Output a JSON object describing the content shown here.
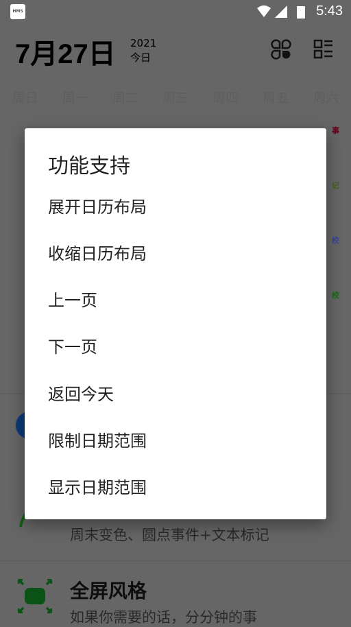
{
  "status_bar": {
    "app_icon": "HMS",
    "time": "5:43",
    "icons": [
      "wifi-icon",
      "signal-icon",
      "battery-charging-icon"
    ]
  },
  "header": {
    "date": "7月27日",
    "year": "2021",
    "today": "今日",
    "icons": [
      "clover-icon",
      "list-layout-icon"
    ]
  },
  "week_days": [
    "周日",
    "周一",
    "周二",
    "周三",
    "周四",
    "周五",
    "周六"
  ],
  "calendar_marks": [
    {
      "text": "事",
      "color": "#a8002a"
    },
    {
      "text": "记",
      "color": "#6b8e23"
    },
    {
      "text": "校",
      "color": "#5060c0"
    },
    {
      "text": "校",
      "color": "#2a9a2a"
    }
  ],
  "features": [
    {
      "subtitle": "周末变色、圆点事件+文本标记",
      "icon": "leaf-icon",
      "color": "#1f8a1f"
    },
    {
      "title": "全屏风格",
      "subtitle": "如果你需要的话，分分钟的事",
      "icon": "fullscreen-icon",
      "color": "#0c6b1c"
    }
  ],
  "dialog": {
    "title": "功能支持",
    "items": [
      "展开日历布局",
      "收缩日历布局",
      "上一页",
      "下一页",
      "返回今天",
      "限制日期范围",
      "显示日期范围"
    ]
  }
}
